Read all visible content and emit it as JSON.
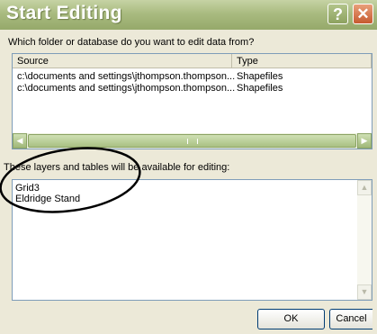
{
  "dialog": {
    "title": "Start Editing",
    "help_glyph": "?",
    "close_glyph": "✕",
    "prompt": "Which folder or database do you want to edit data from?",
    "columns": {
      "source": "Source",
      "type": "Type"
    },
    "rows": [
      {
        "source": "c:\\documents and settings\\jthompson.thompson...",
        "type": "Shapefiles"
      },
      {
        "source": "c:\\documents and settings\\jthompson.thompson...",
        "type": "Shapefiles"
      }
    ],
    "layers_label": "These layers and tables will be available for editing:",
    "layers": [
      "Grid3",
      "Eldridge Stand"
    ],
    "ok_label": "OK",
    "cancel_label": "Cancel"
  },
  "colors": {
    "titlebar": "#a9bb80",
    "face": "#ece9d8",
    "annotation": "#000000"
  },
  "icons": [
    "help-icon",
    "close-icon",
    "scroll-left-icon",
    "scroll-right-icon",
    "scroll-up-icon",
    "scroll-down-icon"
  ]
}
